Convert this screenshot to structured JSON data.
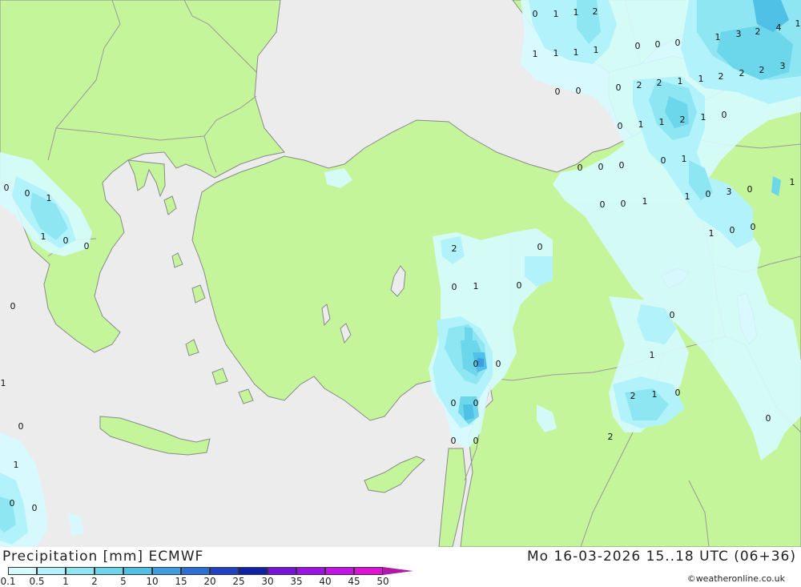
{
  "title": "Precipitation [mm] ECMWF",
  "valid_time": "Mo 16-03-2026 15..18 UTC (06+36)",
  "credit": "©weatheronline.co.uk",
  "colors": {
    "sea": "#ececec",
    "land": "#c4f59a",
    "border": "#9a9a9a",
    "coast": "#8a8a8a"
  },
  "legend": {
    "ticks": [
      "0.1",
      "0.5",
      "1",
      "2",
      "5",
      "10",
      "15",
      "20",
      "25",
      "30",
      "35",
      "40",
      "45",
      "50"
    ],
    "colors": [
      "#d6fbff",
      "#b2f3fb",
      "#8ee6f2",
      "#6cd6ea",
      "#4fc0e6",
      "#3a9ee0",
      "#2a6fd8",
      "#2040c8",
      "#1020a8",
      "#7a10e0",
      "#a010e8",
      "#c810ea",
      "#e010d8",
      "#b018a8"
    ]
  },
  "labels": [
    {
      "t": "0"
    },
    {
      "t": "1"
    },
    {
      "t": "1"
    },
    {
      "t": "2"
    },
    {
      "t": "1"
    },
    {
      "t": "1"
    },
    {
      "t": "1"
    },
    {
      "t": "1"
    },
    {
      "t": "0"
    },
    {
      "t": "0"
    },
    {
      "t": "0"
    },
    {
      "t": "0"
    },
    {
      "t": "0"
    },
    {
      "t": "1"
    },
    {
      "t": "3"
    },
    {
      "t": "2"
    },
    {
      "t": "4"
    },
    {
      "t": "1"
    },
    {
      "t": "0"
    },
    {
      "t": "2"
    },
    {
      "t": "2"
    },
    {
      "t": "1"
    },
    {
      "t": "1"
    },
    {
      "t": "2"
    },
    {
      "t": "2"
    },
    {
      "t": "2"
    },
    {
      "t": "3"
    },
    {
      "t": "0"
    },
    {
      "t": "1"
    },
    {
      "t": "1"
    },
    {
      "t": "2"
    },
    {
      "t": "1"
    },
    {
      "t": "0"
    },
    {
      "t": "0"
    },
    {
      "t": "0"
    },
    {
      "t": "0"
    },
    {
      "t": "0"
    },
    {
      "t": "1"
    },
    {
      "t": "0"
    },
    {
      "t": "0"
    },
    {
      "t": "1"
    },
    {
      "t": "1"
    },
    {
      "t": "0"
    },
    {
      "t": "3"
    },
    {
      "t": "0"
    },
    {
      "t": "1"
    },
    {
      "t": "1"
    },
    {
      "t": "0"
    },
    {
      "t": "0"
    },
    {
      "t": "0"
    },
    {
      "t": "0"
    },
    {
      "t": "1"
    },
    {
      "t": "1"
    },
    {
      "t": "0"
    },
    {
      "t": "0"
    },
    {
      "t": "2"
    },
    {
      "t": "0"
    },
    {
      "t": "0"
    },
    {
      "t": "1"
    },
    {
      "t": "0"
    },
    {
      "t": "0"
    },
    {
      "t": "0"
    },
    {
      "t": "1"
    },
    {
      "t": "0"
    },
    {
      "t": "0"
    },
    {
      "t": "1"
    },
    {
      "t": "0"
    },
    {
      "t": "0"
    },
    {
      "t": "0"
    },
    {
      "t": "2"
    },
    {
      "t": "2"
    },
    {
      "t": "1"
    },
    {
      "t": "0"
    },
    {
      "t": "0"
    },
    {
      "t": "0"
    },
    {
      "t": "0"
    },
    {
      "t": "1"
    },
    {
      "t": "0"
    },
    {
      "t": "0"
    }
  ]
}
